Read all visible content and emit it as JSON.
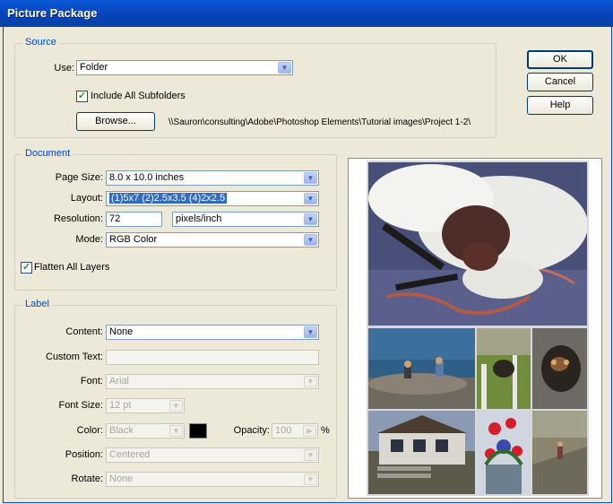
{
  "window": {
    "title": "Picture Package"
  },
  "buttons": {
    "ok": "OK",
    "cancel": "Cancel",
    "help": "Help"
  },
  "source": {
    "legend": "Source",
    "use_label": "Use:",
    "use_value": "Folder",
    "include_subfolders_label": "Include All Subfolders",
    "include_subfolders_checked": true,
    "browse_label": "Browse...",
    "path": "\\\\Sauron\\consulting\\Adobe\\Photoshop Elements\\Tutorial images\\Project 1-2\\"
  },
  "document": {
    "legend": "Document",
    "page_size_label": "Page Size:",
    "page_size_value": "8.0 x 10.0 inches",
    "layout_label": "Layout:",
    "layout_value": "(1)5x7 (2)2.5x3.5 (4)2x2.5",
    "resolution_label": "Resolution:",
    "resolution_value": "72",
    "resolution_unit": "pixels/inch",
    "mode_label": "Mode:",
    "mode_value": "RGB Color",
    "flatten_label": "Flatten All Layers",
    "flatten_checked": true
  },
  "label": {
    "legend": "Label",
    "content_label": "Content:",
    "content_value": "None",
    "custom_text_label": "Custom Text:",
    "custom_text_value": "",
    "font_label": "Font:",
    "font_value": "Arial",
    "font_size_label": "Font Size:",
    "font_size_value": "12 pt",
    "color_label": "Color:",
    "color_value": "Black",
    "opacity_label": "Opacity:",
    "opacity_value": "100",
    "opacity_unit": "%",
    "position_label": "Position:",
    "position_value": "Centered",
    "rotate_label": "Rotate:",
    "rotate_value": "None"
  },
  "colors": {
    "accent": "#316ac5",
    "legend": "#0046d5",
    "titlebar": "#0a58d8"
  },
  "icons": {
    "dropdown": "chevron-down-icon",
    "checkbox": "checkmark-icon"
  }
}
